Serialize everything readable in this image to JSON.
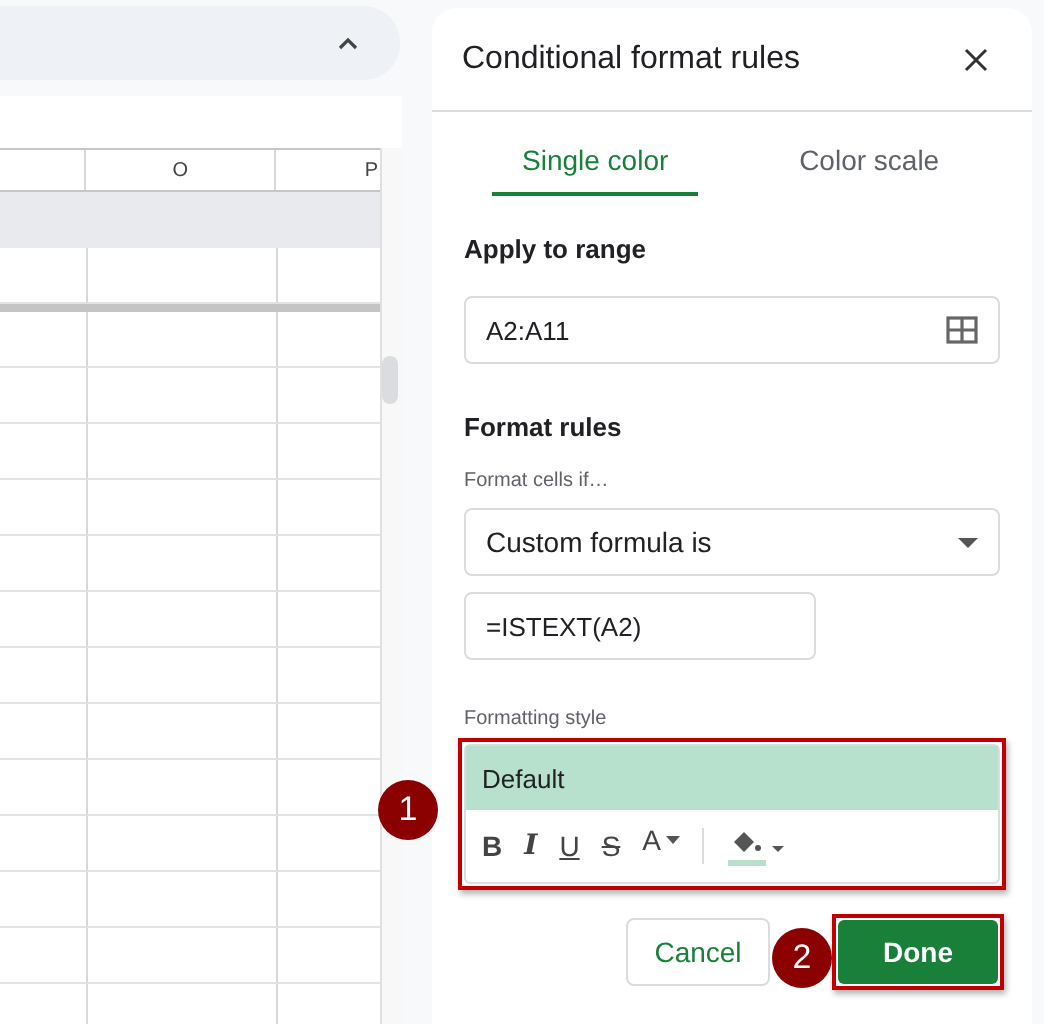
{
  "sheet": {
    "columns": [
      "O",
      "P"
    ]
  },
  "panel": {
    "title": "Conditional format rules",
    "tabs": [
      {
        "label": "Single color",
        "selected": true
      },
      {
        "label": "Color scale",
        "selected": false
      }
    ],
    "range_label": "Apply to range",
    "range_value": "A2:A11",
    "rules_label": "Format rules",
    "condition_label": "Format cells if…",
    "condition_value": "Custom formula is",
    "formula_value": "=ISTEXT(A2)",
    "style_label": "Formatting style",
    "style_preview": "Default",
    "style_tools": [
      {
        "kind": "bold",
        "glyph": "B"
      },
      {
        "kind": "italic",
        "glyph": "I"
      },
      {
        "kind": "underline",
        "glyph": "U"
      },
      {
        "kind": "strike",
        "glyph": "S"
      },
      {
        "kind": "text-color",
        "glyph": "A"
      },
      {
        "kind": "fill-color"
      }
    ],
    "cancel": "Cancel",
    "done": "Done"
  },
  "callouts": [
    "1",
    "2"
  ]
}
